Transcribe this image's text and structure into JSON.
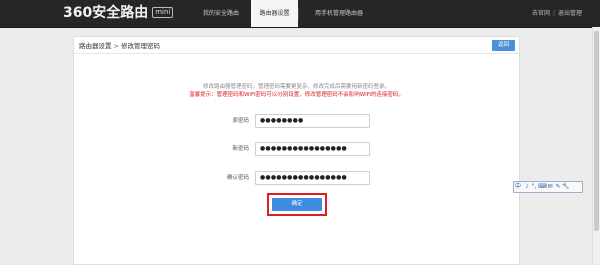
{
  "brand": {
    "name": "360安全路由",
    "badge": "mini"
  },
  "nav": {
    "tabs": [
      {
        "label": "我的安全路由"
      },
      {
        "label": "路由器设置"
      },
      {
        "label": "用手机管理路由器"
      }
    ]
  },
  "user": {
    "account": "去官网",
    "logout": "退出管理"
  },
  "panel": {
    "breadcrumb_root": "路由器设置",
    "breadcrumb_sep": ">",
    "breadcrumb_current": "修改管理密码",
    "back_label": "返回"
  },
  "notice": {
    "line1": "修改路由器管理密码，管理密码需要更复杂，修改完成后需要用新密码登录。",
    "line2": "温馨提示：管理密码和WiFi密码可以分别设置，修改管理密码不会影响WiFi的连接密码。"
  },
  "form": {
    "fields": [
      {
        "label": "原密码",
        "value": "●●●●●●●●"
      },
      {
        "label": "新密码",
        "value": "●●●●●●●●●●●●●●●●"
      },
      {
        "label": "确认密码",
        "value": "●●●●●●●●●●●●●●●●"
      }
    ],
    "submit_label": "确定"
  },
  "ime": {
    "items": [
      "中",
      "☽",
      "°,",
      "⌨",
      "✉",
      "✎",
      "🔧"
    ]
  }
}
